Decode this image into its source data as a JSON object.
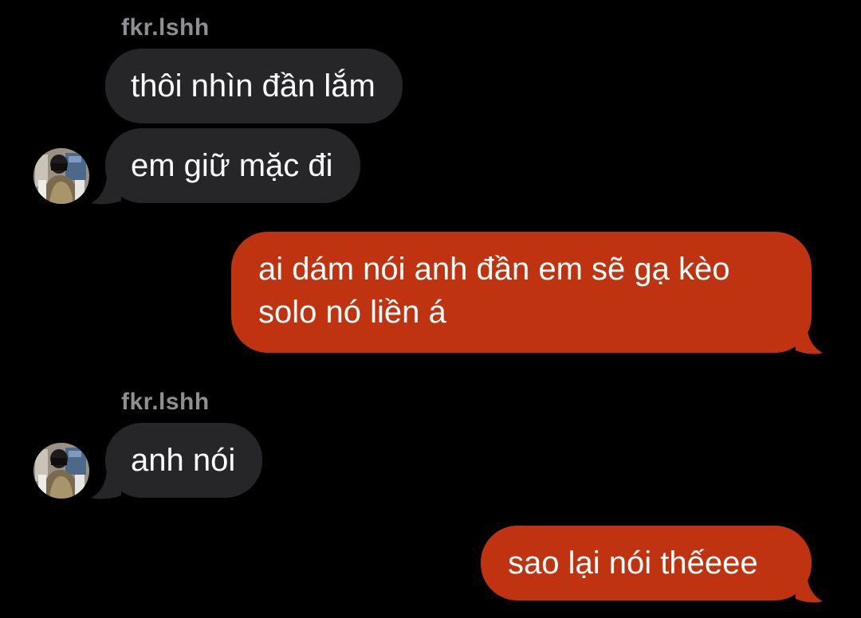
{
  "conversation": {
    "sender_name_1": "fkr.lshh",
    "sender_name_2": "fkr.lshh",
    "messages": [
      {
        "direction": "incoming",
        "text": "thôi nhìn đần lắm"
      },
      {
        "direction": "incoming",
        "text": "em giữ mặc đi"
      },
      {
        "direction": "outgoing",
        "text": "ai dám nói anh đần em sẽ gạ kèo solo nó liền á"
      },
      {
        "direction": "incoming",
        "text": "anh nói"
      },
      {
        "direction": "outgoing",
        "text": "sao lại nói thếeee"
      }
    ]
  },
  "colors": {
    "background": "#000000",
    "incoming_bubble": "#262628",
    "outgoing_bubble": "#bf3310",
    "sender_name": "#8e8e93",
    "text": "#ffffff"
  },
  "icons": {
    "avatar": "contact-avatar-photo"
  }
}
